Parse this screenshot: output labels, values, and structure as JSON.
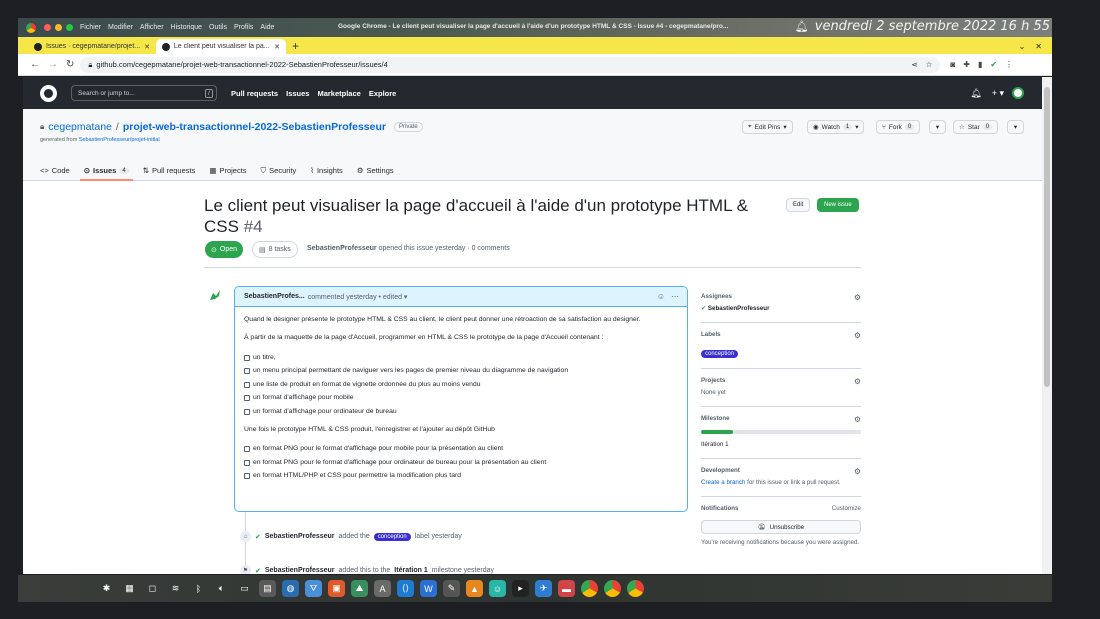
{
  "os": {
    "menu": [
      "Fichier",
      "Modifier",
      "Afficher",
      "Historique",
      "Outils",
      "Profils",
      "Aide"
    ],
    "window_title": "Google Chrome - Le client peut visualiser la page d'accueil à l'aide d'un prototype HTML & CSS - Issue #4 - cegepmatane/pro...",
    "clock": "vendredi 2 septembre 2022  16 h 55"
  },
  "browser": {
    "tabs": [
      {
        "label": "Issues · cegepmatane/projet..."
      },
      {
        "label": "Le client peut visualiser la pa..."
      }
    ],
    "url": "github.com/cegepmatane/projet-web-transactionnel-2022-SebastienProfesseur/issues/4"
  },
  "gh_header": {
    "search_placeholder": "Search or jump to...",
    "slash": "/",
    "nav": [
      "Pull requests",
      "Issues",
      "Marketplace",
      "Explore"
    ]
  },
  "repo": {
    "owner": "cegepmatane",
    "sep": "/",
    "name": "projet-web-transactionnel-2022-SebastienProfesseur",
    "visibility": "Private",
    "generated_prefix": "generated from ",
    "generated_link": "SebastienProfesseur/projet-initial",
    "buttons": {
      "edit_pins": "Edit Pins",
      "watch": "Watch",
      "watch_count": "1",
      "fork": "Fork",
      "fork_count": "0",
      "star": "Star",
      "star_count": "0"
    },
    "tabs": [
      {
        "label": "Code",
        "icon": "<>"
      },
      {
        "label": "Issues",
        "icon": "⊙",
        "count": "4"
      },
      {
        "label": "Pull requests",
        "icon": "⇅"
      },
      {
        "label": "Projects",
        "icon": "▦"
      },
      {
        "label": "Security",
        "icon": "⛉"
      },
      {
        "label": "Insights",
        "icon": "⌇"
      },
      {
        "label": "Settings",
        "icon": "⚙"
      }
    ]
  },
  "issue": {
    "title": "Le client peut visualiser la page d'accueil à l'aide d'un prototype HTML & CSS",
    "number": "#4",
    "edit": "Edit",
    "new_issue": "New issue",
    "state": "Open",
    "tasks": "8 tasks",
    "author": "SebastienProfesseur",
    "opened_text": " opened this issue yesterday · 0 comments"
  },
  "comment": {
    "author": "SebastienProfes...",
    "meta": "commented yesterday • edited ▾",
    "intro": "Quand le designer présente le prototype HTML & CSS au client, le client peut donner une rétroaction de sa satisfaction au designer.",
    "para2": "À partir de la maquette de la page d'Accueil, programmer en HTML & CSS le prototype de la page d'Accueil contenant :",
    "tasks1": [
      "un titre,",
      "un menu principal permettant de naviguer vers les pages de premier niveau du diagramme de navigation",
      "une liste de produit en format de vignette ordonnée du plus au moins vendu",
      "un format d'affichage pour mobile",
      "un format d'affichage pour ordinateur de bureau"
    ],
    "para3": "Une fois le prototype HTML & CSS produit, l'enregistrer et l'ajouter au dépôt GitHub",
    "tasks2": [
      "en format PNG pour le format d'affichage pour mobile pour la présentation au client",
      "en format PNG pour le format d'affichage pour ordinateur de bureau pour la présentation au client",
      "en format HTML/PHP et CSS pour permettre la modification plus tard"
    ]
  },
  "events": {
    "e1_user": "SebastienProfesseur",
    "e1_text": "added the",
    "e1_label": "conception",
    "e1_suffix": "label yesterday",
    "e2_user": "SebastienProfesseur",
    "e2_text": "added this to the",
    "e2_milestone": "Itération 1",
    "e2_suffix": "milestone yesterday"
  },
  "sidebar": {
    "assignees_title": "Assignees",
    "assignee": "SebastienProfesseur",
    "labels_title": "Labels",
    "label": "conception",
    "projects_title": "Projects",
    "projects_value": "None yet",
    "milestone_title": "Milestone",
    "milestone_progress": 0.2,
    "milestone_value": "Itération 1",
    "development_title": "Development",
    "development_link": "Create a branch",
    "development_text": " for this issue or link a pull request.",
    "notifications_title": "Notifications",
    "customize": "Customize",
    "unsubscribe": "Unsubscribe",
    "notif_text": "You're receiving notifications because you were assigned."
  },
  "colors": {
    "accent_green": "#2da44e",
    "link_blue": "#0969da",
    "label_purple": "#3b2fd1",
    "tab_underline": "#fd8c73"
  }
}
